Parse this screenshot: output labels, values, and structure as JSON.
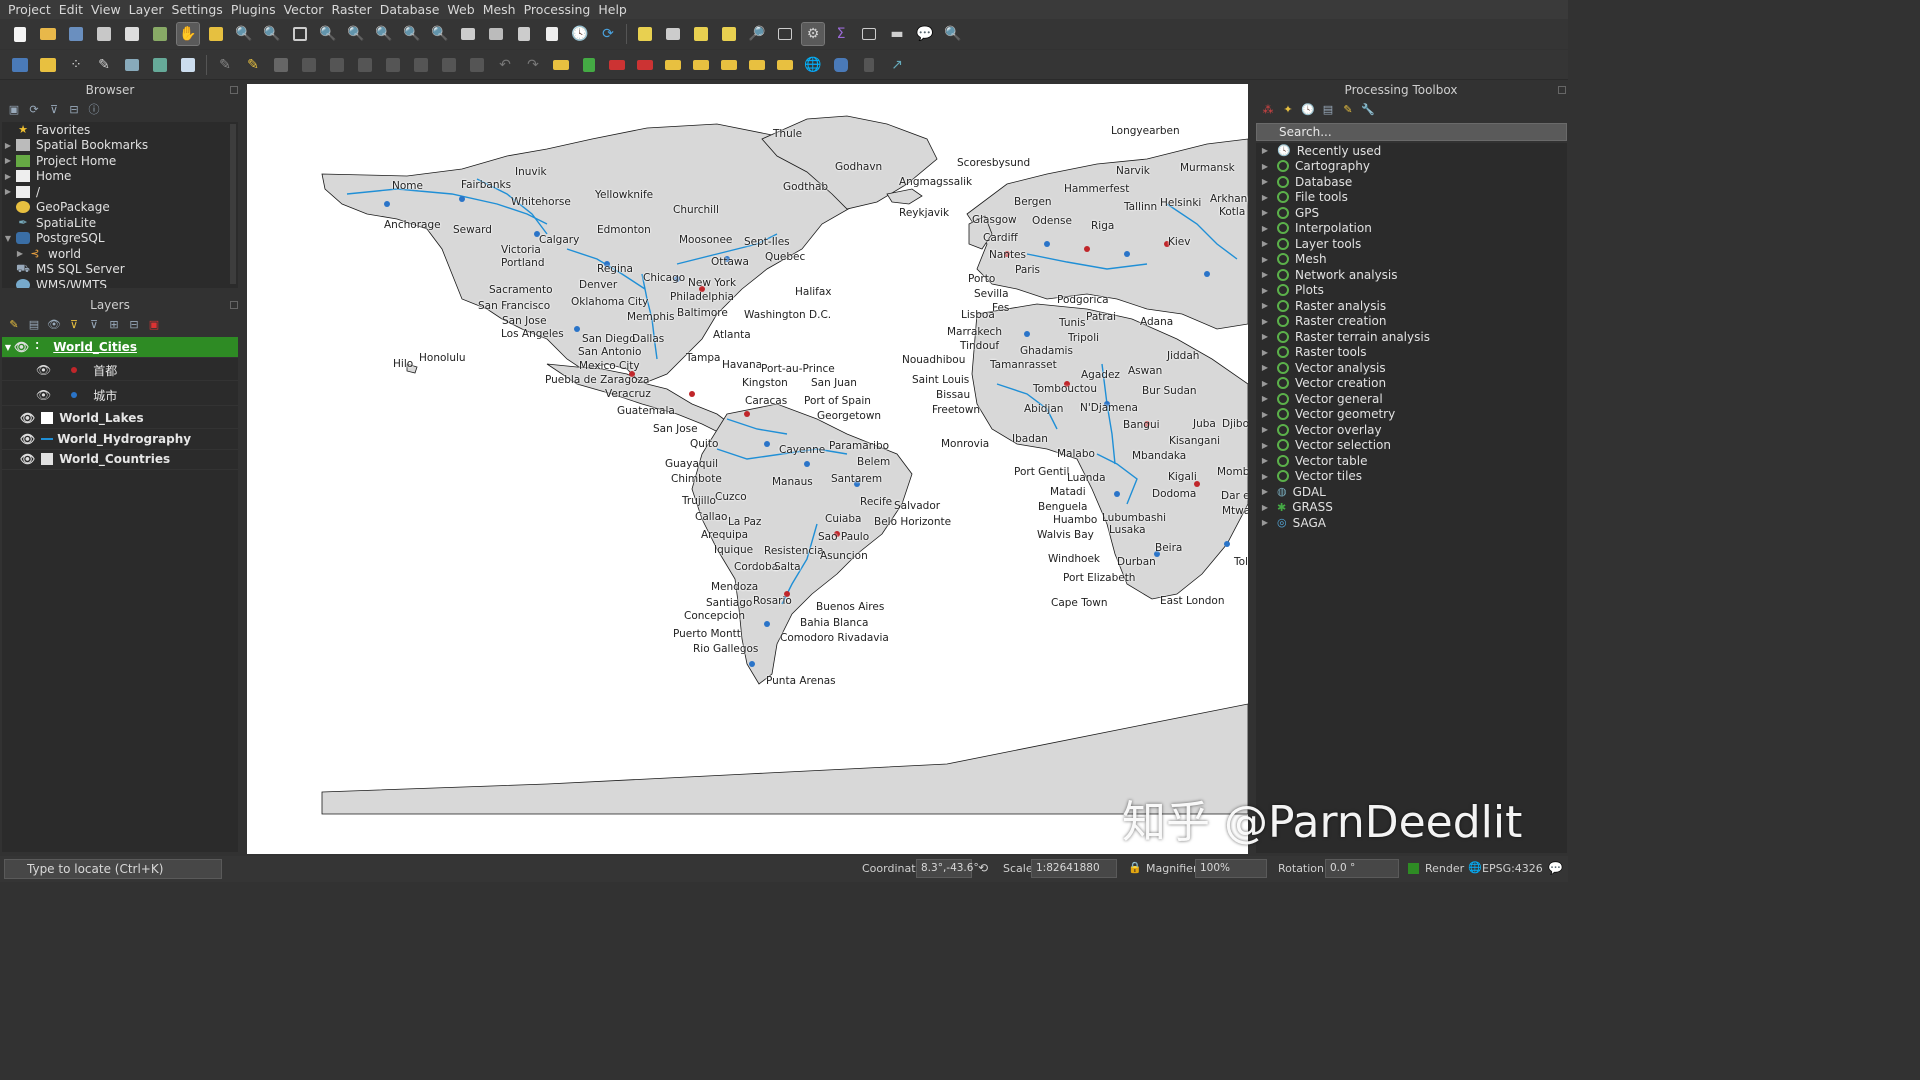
{
  "menu": [
    "Project",
    "Edit",
    "View",
    "Layer",
    "Settings",
    "Plugins",
    "Vector",
    "Raster",
    "Database",
    "Web",
    "Mesh",
    "Processing",
    "Help"
  ],
  "browser": {
    "title": "Browser",
    "items": [
      {
        "label": "Favorites",
        "icon": "star-icon",
        "expandable": false
      },
      {
        "label": "Spatial Bookmarks",
        "icon": "bookmark-icon",
        "expandable": true
      },
      {
        "label": "Project Home",
        "icon": "project-home-icon",
        "expandable": true
      },
      {
        "label": "Home",
        "icon": "home-icon",
        "expandable": true
      },
      {
        "label": "/",
        "icon": "folder-icon",
        "expandable": true
      },
      {
        "label": "GeoPackage",
        "icon": "geopackage-icon",
        "expandable": false
      },
      {
        "label": "SpatiaLite",
        "icon": "spatialite-icon",
        "expandable": false
      },
      {
        "label": "PostgreSQL",
        "icon": "postgresql-icon",
        "expandable": true
      },
      {
        "label": "world",
        "icon": "database-connection-icon",
        "expandable": true
      },
      {
        "label": "MS SQL Server",
        "icon": "mssql-icon",
        "expandable": false
      },
      {
        "label": "WMS/WMTS",
        "icon": "wms-icon",
        "expandable": false
      }
    ]
  },
  "layers": {
    "title": "Layers",
    "items": [
      {
        "label": "World_Cities",
        "selected": true
      },
      {
        "label": "首都",
        "sub": true
      },
      {
        "label": "城市",
        "sub": true
      },
      {
        "label": "World_Lakes"
      },
      {
        "label": "World_Hydrography"
      },
      {
        "label": "World_Countries"
      }
    ]
  },
  "map": {
    "labels": [
      "Nome",
      "Fairbanks",
      "Inuvik",
      "Yellowknife",
      "Whitehorse",
      "Anchorage",
      "Seward",
      "Churchill",
      "Calgary",
      "Edmonton",
      "Moosonee",
      "Sept-Iles",
      "Quebec",
      "Regina",
      "Chicago",
      "Ottawa",
      "New York",
      "Philadelphia",
      "Baltimore",
      "Washington D.C.",
      "Halifax",
      "Denver",
      "Oklahoma City",
      "Memphis",
      "San Francisco",
      "Sacramento",
      "Victoria",
      "Portland",
      "San Jose",
      "Los Angeles",
      "San Diego",
      "Dallas",
      "Atlanta",
      "San Antonio",
      "Mexico City",
      "Puebla de Zaragoza",
      "Veracruz",
      "Havana",
      "Tampa",
      "Port-au-Prince",
      "Kingston",
      "San Juan",
      "Guatemala",
      "Caracas",
      "Port of Spain",
      "Georgetown",
      "Paramaribo",
      "Cayenne",
      "Belem",
      "San Jose",
      "Quito",
      "Guayaquil",
      "Chimbote",
      "Trujillo",
      "Cuzco",
      "Callao",
      "La Paz",
      "Manaus",
      "Santarem",
      "Recife",
      "Salvador",
      "Arequipa",
      "Iquique",
      "Cuiaba",
      "Belo Horizonte",
      "Sao Paulo",
      "Resistencia",
      "Asuncion",
      "Cordoba",
      "Salta",
      "Mendoza",
      "Santiago",
      "Rosario",
      "Buenos Aires",
      "Concepcion",
      "Bahia Blanca",
      "Puerto Montt",
      "Comodoro Rivadavia",
      "Rio Gallegos",
      "Punta Arenas",
      "Hilo",
      "Honolulu",
      "Thule",
      "Godhavn",
      "Godthab",
      "Angmagssalik",
      "Scoresbysund",
      "Reykjavik",
      "Longyearben",
      "Narvik",
      "Murmansk",
      "Hammerfest",
      "Bergen",
      "Tallinn",
      "Helsinki",
      "Arkhang",
      "Kotla",
      "Glasgow",
      "Odense",
      "Cardiff",
      "Riga",
      "Kiev",
      "Nantes",
      "Paris",
      "Porto",
      "Sevilla",
      "Lisboa",
      "Fes",
      "Podgorica",
      "Tunis",
      "Patrai",
      "Marrakech",
      "Tindouf",
      "Ghadamis",
      "Tripoli",
      "Adana",
      "Nouadhibou",
      "Tamanrasset",
      "Jiddah",
      "Saint Louis",
      "Bissau",
      "Freetown",
      "Monrovia",
      "Tombouctou",
      "Agadez",
      "Aswan",
      "Bur Sudan",
      "Abidjan",
      "N'Djamena",
      "Ibadan",
      "Bangui",
      "Juba",
      "Djibouti",
      "Malabo",
      "Port Gentil",
      "Kisangani",
      "Mbandaka",
      "Kigali",
      "Mombasa",
      "Luanda",
      "Matadi",
      "Dodoma",
      "Dar es Salaam",
      "Benguela",
      "Huambo",
      "Lubumbashi",
      "Mtwara",
      "Walvis Bay",
      "Lusaka",
      "Beira",
      "Windhoek",
      "Durban",
      "Toliara",
      "Port Elizabeth",
      "Cape Town",
      "East London"
    ],
    "colors": {
      "water": "#ffffff",
      "land": "#d8d8d8",
      "border": "#1a1a1a",
      "rivers": "#1f8fd6",
      "capital_pin": "#c0262a",
      "city_pin": "#2a74c8"
    }
  },
  "toolbox": {
    "title": "Processing Toolbox",
    "search_placeholder": "Search...",
    "items": [
      "Recently used",
      "Cartography",
      "Database",
      "File tools",
      "GPS",
      "Interpolation",
      "Layer tools",
      "Mesh",
      "Network analysis",
      "Plots",
      "Raster analysis",
      "Raster creation",
      "Raster terrain analysis",
      "Raster tools",
      "Vector analysis",
      "Vector creation",
      "Vector general",
      "Vector geometry",
      "Vector overlay",
      "Vector selection",
      "Vector table",
      "Vector tiles",
      "GDAL",
      "GRASS",
      "SAGA"
    ]
  },
  "status": {
    "locator_placeholder": "Type to locate (Ctrl+K)",
    "coordinate_label": "Coordinate",
    "coordinate_value": "8.3°,-43.6°",
    "scale_label": "Scale",
    "scale_value": "1:82641880",
    "magnifier_label": "Magnifier",
    "magnifier_value": "100%",
    "rotation_label": "Rotation",
    "rotation_value": "0.0 °",
    "render_label": "Render",
    "crs": "EPSG:4326"
  },
  "watermark": "知乎 @ParnDeedlit"
}
